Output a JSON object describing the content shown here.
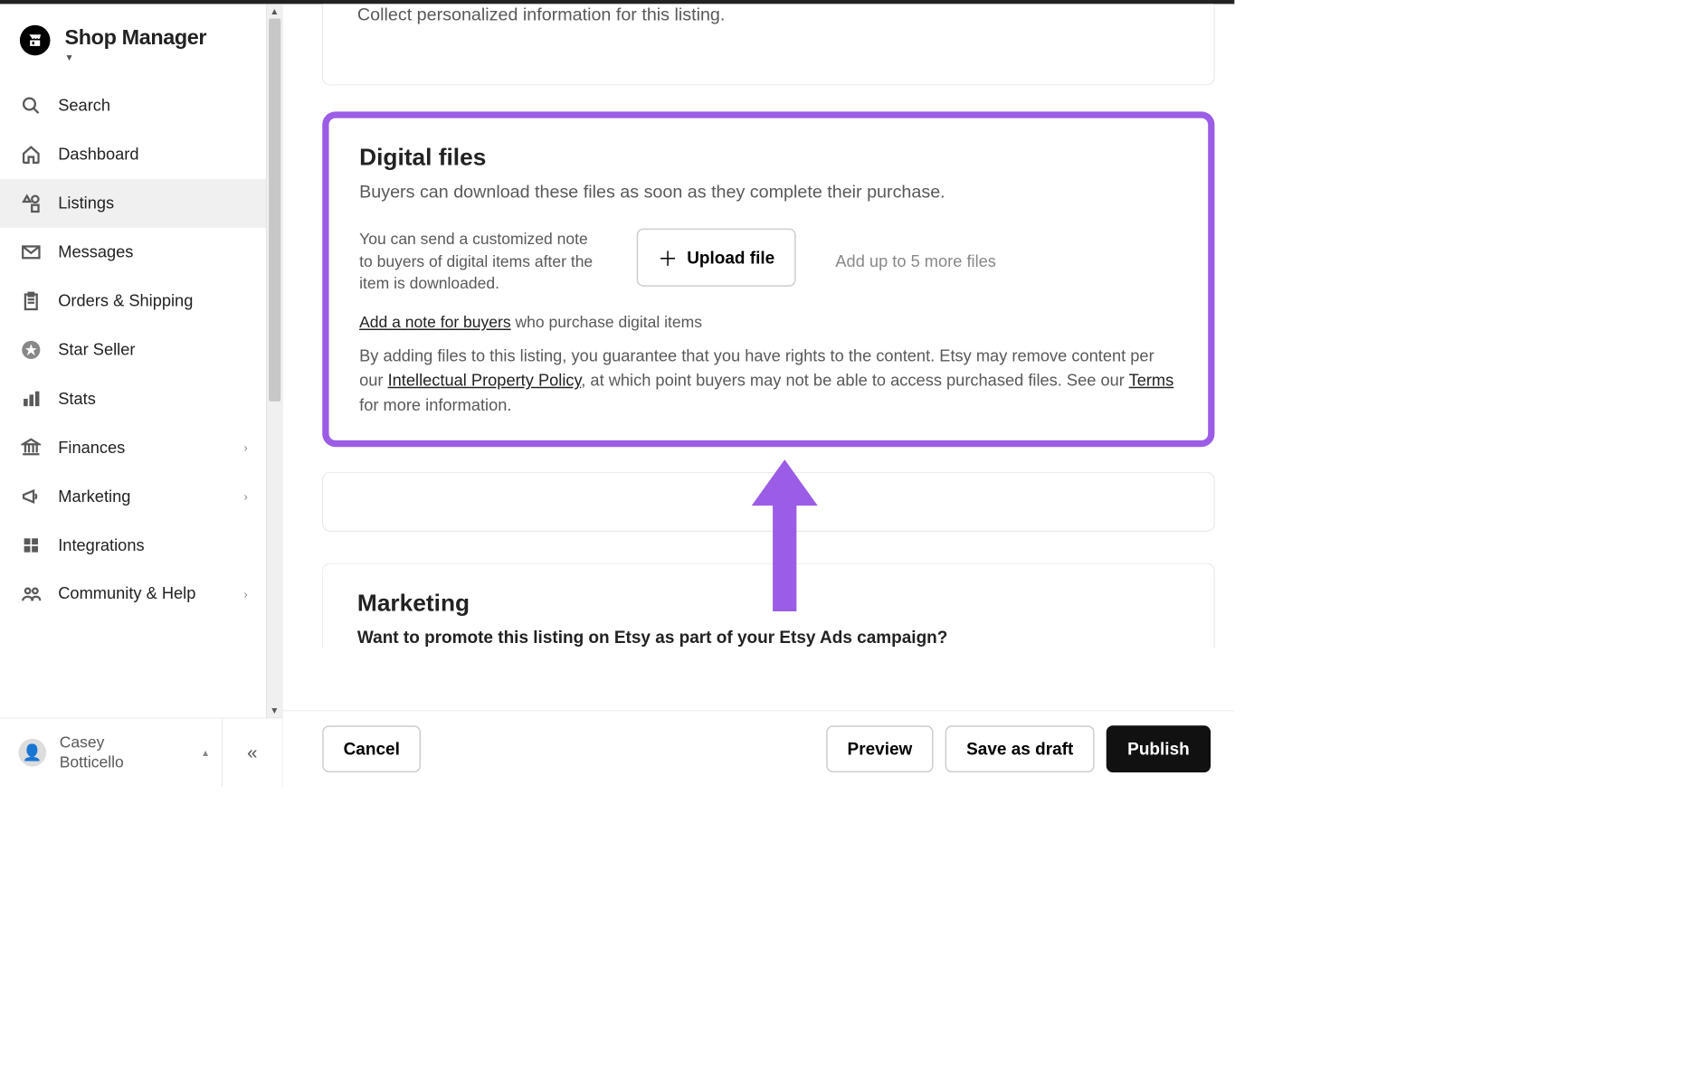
{
  "header": {
    "title": "Shop Manager"
  },
  "sidebar": {
    "items": [
      {
        "label": "Search"
      },
      {
        "label": "Dashboard"
      },
      {
        "label": "Listings"
      },
      {
        "label": "Messages"
      },
      {
        "label": "Orders & Shipping"
      },
      {
        "label": "Star Seller"
      },
      {
        "label": "Stats"
      },
      {
        "label": "Finances"
      },
      {
        "label": "Marketing"
      },
      {
        "label": "Integrations"
      },
      {
        "label": "Community & Help"
      }
    ]
  },
  "user": {
    "name_line1": "Casey",
    "name_line2": "Botticello"
  },
  "personalization": {
    "desc": "Collect personalized information for this listing."
  },
  "digital": {
    "title": "Digital files",
    "desc": "Buyers can download these files as soon as they complete their purchase.",
    "note_text": "You can send a customized note to buyers of digital items after the item is downloaded.",
    "add_note_link": "Add a note for buyers",
    "add_note_rest": " who purchase digital items",
    "upload_label": "Upload file",
    "upload_hint": "Add up to 5 more files",
    "disclaimer_pre": "By adding files to this listing, you guarantee that you have rights to the content. Etsy may remove content per our ",
    "ip_link": "Intellectual Property Policy",
    "disclaimer_mid": ", at which point buyers may not be able to access purchased files. See our ",
    "terms_link": "Terms",
    "disclaimer_end": " for more information."
  },
  "marketing": {
    "title": "Marketing",
    "prompt": "Want to promote this listing on Etsy as part of your Etsy Ads campaign?"
  },
  "footer": {
    "cancel": "Cancel",
    "preview": "Preview",
    "save_draft": "Save as draft",
    "publish": "Publish"
  }
}
